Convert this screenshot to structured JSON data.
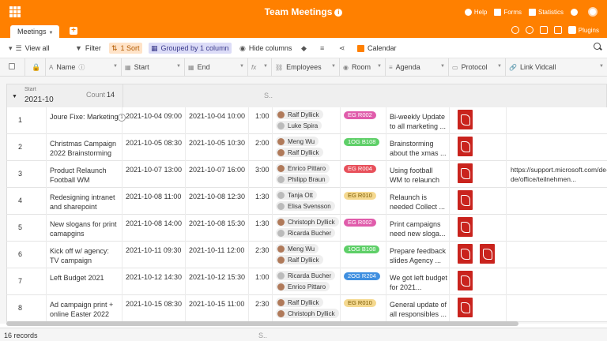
{
  "header": {
    "title": "Team Meetings",
    "help": "Help",
    "forms": "Forms",
    "statistics": "Statistics"
  },
  "tabs": {
    "active": "Meetings",
    "plugins": "Plugins"
  },
  "toolbar": {
    "view": "View all",
    "filter": "Filter",
    "sort": "1 Sort",
    "group": "Grouped by 1 column",
    "hide": "Hide columns",
    "calendar": "Calendar"
  },
  "columns": {
    "name": "Name",
    "start": "Start",
    "end": "End",
    "fx": "fx",
    "employees": "Employees",
    "room": "Room",
    "agenda": "Agenda",
    "protocol": "Protocol",
    "link": "Link Vidcall"
  },
  "group": {
    "label": "Start",
    "value": "2021-10",
    "count_label": "Count",
    "count": "14",
    "summary": "S.."
  },
  "rows": [
    {
      "num": "1",
      "name": "Joure Fixe: Marketing",
      "start": "2021-10-04 09:00",
      "end": "2021-10-04 10:00",
      "duration": "1:00",
      "emp": [
        "Ralf Dyllick",
        "Luke Spira"
      ],
      "room": "EG R002",
      "room_color": "#e05cab",
      "agenda": "Bi-weekly Update to all marketing ...",
      "pdfs": 1,
      "link": "",
      "comments": "1"
    },
    {
      "num": "2",
      "name": "Christmas Campaign 2022 Brainstorming",
      "start": "2021-10-05 08:30",
      "end": "2021-10-05 10:30",
      "duration": "2:00",
      "emp": [
        "Meng Wu",
        "Ralf Dyllick"
      ],
      "room": "1OG B108",
      "room_color": "#5ecf68",
      "agenda": "Brainstorming about the xmas ...",
      "pdfs": 1,
      "link": ""
    },
    {
      "num": "3",
      "name": "Product Relaunch Football WM",
      "start": "2021-10-07 13:00",
      "end": "2021-10-07 16:00",
      "duration": "3:00",
      "emp": [
        "Enrico Pittaro",
        "Philipp Braun"
      ],
      "room": "EG R004",
      "room_color": "#e8505b",
      "agenda": "Using football WM to relaunch ...",
      "pdfs": 1,
      "link": "https://support.microsoft.com/de-de/office/teilnehmen..."
    },
    {
      "num": "4",
      "name": "Redesigning intranet and sharepoint",
      "start": "2021-10-08 11:00",
      "end": "2021-10-08 12:30",
      "duration": "1:30",
      "emp": [
        "Tanja Ott",
        "Elisa Svensson"
      ],
      "room": "EG R010",
      "room_color": "#f5d990",
      "agenda": "Relaunch is needed Collect ...",
      "pdfs": 1,
      "link": ""
    },
    {
      "num": "5",
      "name": "New slogans for print camapgins",
      "start": "2021-10-08 14:00",
      "end": "2021-10-08 15:30",
      "duration": "1:30",
      "emp": [
        "Christoph Dyllick",
        "Ricarda Bucher"
      ],
      "room": "EG R002",
      "room_color": "#e05cab",
      "agenda": "Print campaigns need new sloga...",
      "pdfs": 1,
      "link": ""
    },
    {
      "num": "6",
      "name": "Kick off w/ agency: TV campaign",
      "start": "2021-10-11 09:30",
      "end": "2021-10-11 12:00",
      "duration": "2:30",
      "emp": [
        "Meng Wu",
        "Ralf Dyllick"
      ],
      "room": "1OG B108",
      "room_color": "#5ecf68",
      "agenda": "Prepare feedback slides Agency ...",
      "pdfs": 2,
      "link": ""
    },
    {
      "num": "7",
      "name": "Left Budget 2021",
      "start": "2021-10-12 14:30",
      "end": "2021-10-12 15:30",
      "duration": "1:00",
      "emp": [
        "Ricarda Bucher",
        "Enrico Pittaro"
      ],
      "room": "2OG R204",
      "room_color": "#3f8fe0",
      "agenda": "We got left budget for 2021...",
      "pdfs": 1,
      "link": ""
    },
    {
      "num": "8",
      "name": "Ad campaign print + online Easter 2022",
      "start": "2021-10-15 08:30",
      "end": "2021-10-15 11:00",
      "duration": "2:30",
      "emp": [
        "Ralf Dyllick",
        "Christoph Dyllick"
      ],
      "room": "EG R010",
      "room_color": "#f5d990",
      "agenda": "General update of all responsibles ...",
      "pdfs": 1,
      "link": ""
    }
  ],
  "footer": {
    "records": "16 records",
    "summary": "S.."
  }
}
